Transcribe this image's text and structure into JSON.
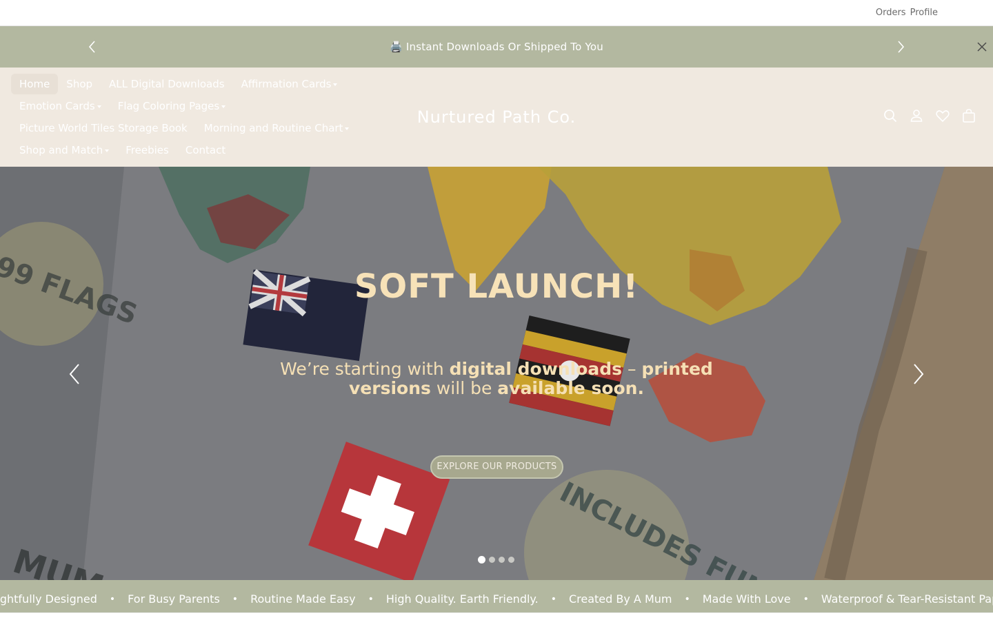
{
  "topbar": {
    "orders_label": "Orders",
    "profile_label": "Profile"
  },
  "announcement": {
    "icon": "printer-icon",
    "text": "🖨️ Instant Downloads Or Shipped To You"
  },
  "nav": {
    "rows": [
      [
        {
          "label": "Home",
          "active": true
        },
        {
          "label": "Shop"
        },
        {
          "label": "ALL Digital Downloads"
        },
        {
          "label": "Affirmation Cards",
          "dropdown": true
        }
      ],
      [
        {
          "label": "Emotion Cards",
          "dropdown": true
        },
        {
          "label": "Flag Coloring Pages",
          "dropdown": true
        }
      ],
      [
        {
          "label": "Picture World Tiles Storage Book"
        },
        {
          "label": "Morning and Routine Chart",
          "dropdown": true
        }
      ],
      [
        {
          "label": "Shop and Match",
          "dropdown": true
        },
        {
          "label": "Freebies"
        },
        {
          "label": "Contact"
        }
      ]
    ]
  },
  "logo": {
    "text": "Nurtured Path Co."
  },
  "header_icons": [
    "search-icon",
    "account-icon",
    "wishlist-heart-icon",
    "cart-bag-icon"
  ],
  "hero": {
    "title": "SOFT LAUNCH!",
    "subtitle_parts": [
      {
        "text": "We’re starting with ",
        "bold": false
      },
      {
        "text": "digital downloads",
        "bold": true
      },
      {
        "text": " – ",
        "bold": false
      },
      {
        "text": "printed versions",
        "bold": true
      },
      {
        "text": " will be ",
        "bold": false
      },
      {
        "text": "available soon.",
        "bold": true
      }
    ],
    "button_label": "EXPLORE OUR PRODUCTS",
    "slides": 4,
    "active_slide": 1,
    "image_text": [
      "99 FLAGS",
      "INCLUDES FUN FA",
      "MUM"
    ]
  },
  "marquee": {
    "items": [
      "Thoughtfully Designed",
      "For Busy Parents",
      "Routine Made Easy",
      "High Quality. Earth Friendly.",
      "Created By A Mum",
      "Made With Love",
      "Waterproof & Tear-Resistant Paper"
    ],
    "separator": "•"
  },
  "colors": {
    "announcement_bg": "#b3b8a0",
    "header_bg": "#f0e9e0",
    "hero_text": "#f7e2b8",
    "button_bg": "#a7a88e"
  }
}
